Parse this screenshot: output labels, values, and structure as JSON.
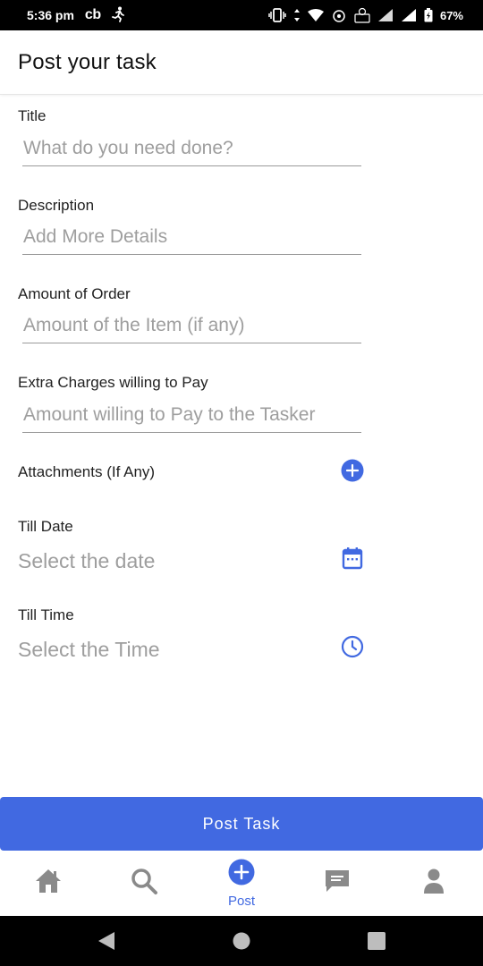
{
  "status_bar": {
    "time": "5:36 pm",
    "carrier": "cb",
    "battery": "67%"
  },
  "header": {
    "title": "Post your task"
  },
  "form": {
    "title": {
      "label": "Title",
      "placeholder": "What do you need done?"
    },
    "description": {
      "label": "Description",
      "placeholder": "Add More Details"
    },
    "amount": {
      "label": "Amount of Order",
      "placeholder": "Amount of the Item (if any)"
    },
    "extra_charges": {
      "label": "Extra Charges willing to Pay",
      "placeholder": "Amount willing to Pay to the Tasker"
    },
    "attachments": {
      "label": "Attachments (If Any)"
    },
    "till_date": {
      "label": "Till Date",
      "value": "Select the date"
    },
    "till_time": {
      "label": "Till Time",
      "value": "Select the Time"
    }
  },
  "actions": {
    "post_task_label": "Post Task"
  },
  "bottom_nav": {
    "items": [
      {
        "icon": "home-icon",
        "label": ""
      },
      {
        "icon": "search-icon",
        "label": ""
      },
      {
        "icon": "add-circle-icon",
        "label": "Post"
      },
      {
        "icon": "chat-icon",
        "label": ""
      },
      {
        "icon": "person-icon",
        "label": ""
      }
    ]
  },
  "colors": {
    "accent": "#4169e1",
    "placeholder": "#9e9e9e",
    "nav_icon_inactive": "#8a8a8a"
  }
}
